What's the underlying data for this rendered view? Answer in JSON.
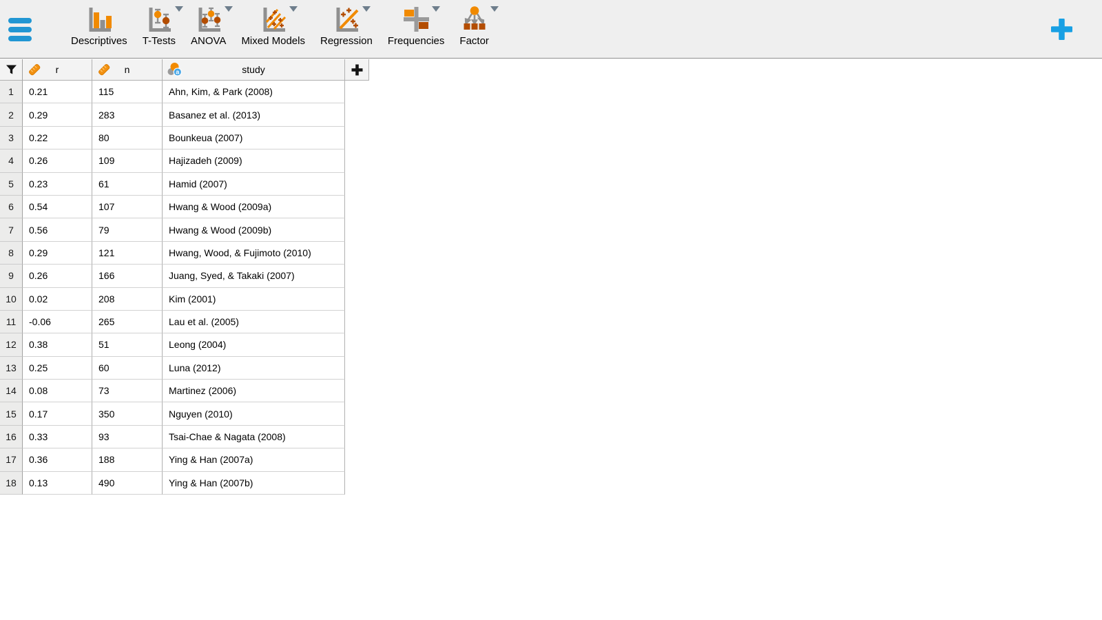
{
  "colors": {
    "accent_blue": "#2196d3",
    "icon_orange": "#f18a00",
    "icon_dark_orange": "#b34d00",
    "icon_gray": "#8f8f8f",
    "toolbar_bg": "#efefef",
    "header_bg": "#f3f3f3",
    "row_number_bg": "#ececeb"
  },
  "toolbar": {
    "buttons": [
      {
        "label": "Descriptives",
        "icon": "descriptives-bar-chart-icon",
        "has_dropdown": false
      },
      {
        "label": "T-Tests",
        "icon": "t-tests-icon",
        "has_dropdown": true
      },
      {
        "label": "ANOVA",
        "icon": "anova-icon",
        "has_dropdown": true
      },
      {
        "label": "Mixed Models",
        "icon": "mixed-models-icon",
        "has_dropdown": true
      },
      {
        "label": "Regression",
        "icon": "regression-icon",
        "has_dropdown": true
      },
      {
        "label": "Frequencies",
        "icon": "frequencies-icon",
        "has_dropdown": true
      },
      {
        "label": "Factor",
        "icon": "factor-icon",
        "has_dropdown": true
      }
    ]
  },
  "spreadsheet": {
    "add_column_label": "+",
    "columns": [
      {
        "name": "r",
        "type": "scale",
        "icon": "ruler-scale-icon"
      },
      {
        "name": "n",
        "type": "scale",
        "icon": "ruler-scale-icon"
      },
      {
        "name": "study",
        "type": "nominal-text",
        "icon": "nominal-text-icon"
      }
    ],
    "rows": [
      {
        "row": "1",
        "r": "0.21",
        "n": "115",
        "study": "Ahn, Kim, & Park (2008)"
      },
      {
        "row": "2",
        "r": "0.29",
        "n": "283",
        "study": "Basanez et al. (2013)"
      },
      {
        "row": "3",
        "r": "0.22",
        "n": "80",
        "study": "Bounkeua (2007)"
      },
      {
        "row": "4",
        "r": "0.26",
        "n": "109",
        "study": "Hajizadeh (2009)"
      },
      {
        "row": "5",
        "r": "0.23",
        "n": "61",
        "study": "Hamid (2007)"
      },
      {
        "row": "6",
        "r": "0.54",
        "n": "107",
        "study": "Hwang & Wood (2009a)"
      },
      {
        "row": "7",
        "r": "0.56",
        "n": "79",
        "study": "Hwang & Wood (2009b)"
      },
      {
        "row": "8",
        "r": "0.29",
        "n": "121",
        "study": "Hwang, Wood, & Fujimoto (2010)"
      },
      {
        "row": "9",
        "r": "0.26",
        "n": "166",
        "study": "Juang, Syed, & Takaki (2007)"
      },
      {
        "row": "10",
        "r": "0.02",
        "n": "208",
        "study": "Kim (2001)"
      },
      {
        "row": "11",
        "r": "-0.06",
        "n": "265",
        "study": "Lau et al. (2005)"
      },
      {
        "row": "12",
        "r": "0.38",
        "n": "51",
        "study": "Leong (2004)"
      },
      {
        "row": "13",
        "r": "0.25",
        "n": "60",
        "study": "Luna (2012)"
      },
      {
        "row": "14",
        "r": "0.08",
        "n": "73",
        "study": "Martinez (2006)"
      },
      {
        "row": "15",
        "r": "0.17",
        "n": "350",
        "study": "Nguyen (2010)"
      },
      {
        "row": "16",
        "r": "0.33",
        "n": "93",
        "study": "Tsai-Chae & Nagata (2008)"
      },
      {
        "row": "17",
        "r": "0.36",
        "n": "188",
        "study": "Ying & Han (2007a)"
      },
      {
        "row": "18",
        "r": "0.13",
        "n": "490",
        "study": "Ying & Han (2007b)"
      }
    ]
  }
}
